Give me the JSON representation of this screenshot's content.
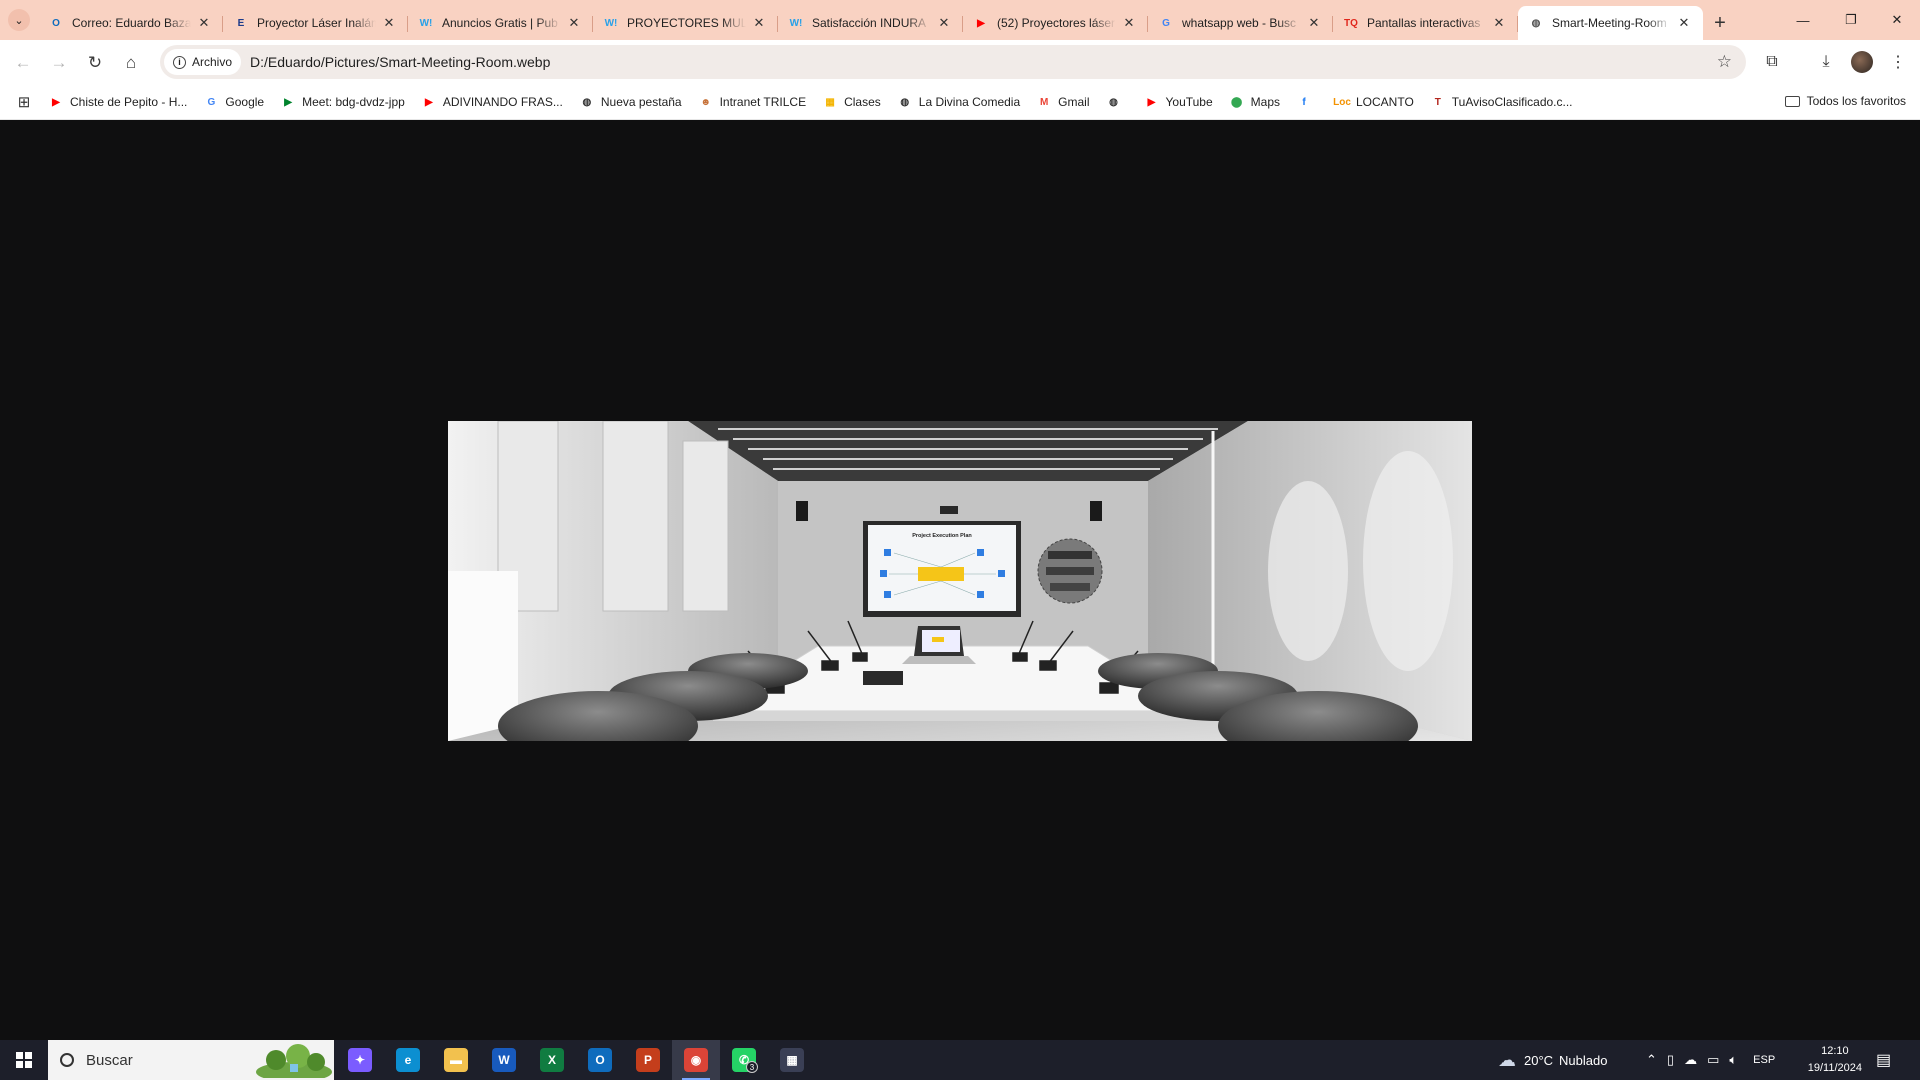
{
  "browser": {
    "tabs": [
      {
        "title": "Correo: Eduardo Baza",
        "favicon": "outlook-icon",
        "color": "#0f6cbd",
        "glyph": "O"
      },
      {
        "title": "Proyector Láser Inalám",
        "favicon": "e-letter-icon",
        "color": "#1b3a8a",
        "glyph": "E"
      },
      {
        "title": "Anuncios Gratis | Pub",
        "favicon": "w-logo-icon",
        "color": "#2aa1e8",
        "glyph": "W!"
      },
      {
        "title": "PROYECTORES MULTI",
        "favicon": "w-logo-icon",
        "color": "#2aa1e8",
        "glyph": "W!"
      },
      {
        "title": "Satisfacción INDURA",
        "favicon": "w-logo-icon",
        "color": "#2aa1e8",
        "glyph": "W!"
      },
      {
        "title": "(52) Proyectores láser",
        "favicon": "youtube-icon",
        "color": "#ff0000",
        "glyph": "▶"
      },
      {
        "title": "whatsapp web - Busc",
        "favicon": "google-icon",
        "color": "#4285f4",
        "glyph": "G"
      },
      {
        "title": "Pantallas interactivas",
        "favicon": "tq-logo-icon",
        "color": "#e0261b",
        "glyph": "TQ"
      },
      {
        "title": "Smart-Meeting-Room",
        "favicon": "globe-icon",
        "color": "#555555",
        "glyph": "◍",
        "active": true
      }
    ],
    "address": {
      "chip_label": "Archivo",
      "url": "D:/Eduardo/Pictures/Smart-Meeting-Room.webp"
    },
    "bookmarks": [
      {
        "label": "Chiste de Pepito - H...",
        "favicon": "youtube-icon",
        "color": "#ff0000",
        "glyph": "▶"
      },
      {
        "label": "Google",
        "favicon": "google-icon",
        "color": "#4285f4",
        "glyph": "G"
      },
      {
        "label": "Meet: bdg-dvdz-jpp",
        "favicon": "meet-icon",
        "color": "#00832d",
        "glyph": "▶"
      },
      {
        "label": "ADIVINANDO FRAS...",
        "favicon": "youtube-icon",
        "color": "#ff0000",
        "glyph": "▶"
      },
      {
        "label": "Nueva pestaña",
        "favicon": "globe-icon",
        "color": "#333333",
        "glyph": "◍"
      },
      {
        "label": "Intranet TRILCE",
        "favicon": "trilce-icon",
        "color": "#c7733a",
        "glyph": "☻"
      },
      {
        "label": "Clases",
        "favicon": "classroom-icon",
        "color": "#f4b400",
        "glyph": "▦"
      },
      {
        "label": "La Divina Comedia",
        "favicon": "globe-icon",
        "color": "#333333",
        "glyph": "◍"
      },
      {
        "label": "Gmail",
        "favicon": "gmail-icon",
        "color": "#ea4335",
        "glyph": "M"
      },
      {
        "label": "",
        "favicon": "globe-icon",
        "color": "#333333",
        "glyph": "◍"
      },
      {
        "label": "YouTube",
        "favicon": "youtube-icon",
        "color": "#ff0000",
        "glyph": "▶"
      },
      {
        "label": "Maps",
        "favicon": "maps-icon",
        "color": "#34a853",
        "glyph": "⬤"
      },
      {
        "label": "",
        "favicon": "facebook-icon",
        "color": "#1877f2",
        "glyph": "f"
      },
      {
        "label": "LOCANTO",
        "favicon": "locanto-icon",
        "color": "#f39200",
        "glyph": "Loc"
      },
      {
        "label": "TuAvisoClasificado.c...",
        "favicon": "tuaviso-icon",
        "color": "#b3261e",
        "glyph": "T"
      }
    ],
    "all_bookmarks_label": "Todos los favoritos"
  },
  "image": {
    "alt": "Smart-Meeting-Room",
    "screen_title": "Project Execution Plan"
  },
  "taskbar": {
    "search_placeholder": "Buscar",
    "apps": [
      {
        "name": "copilot-icon",
        "color": "#7b5cff",
        "glyph": "✦"
      },
      {
        "name": "edge-icon",
        "color": "#0c8fd1",
        "glyph": "e"
      },
      {
        "name": "file-explorer-icon",
        "color": "#f2c14e",
        "glyph": "▬"
      },
      {
        "name": "word-icon",
        "color": "#185abd",
        "glyph": "W"
      },
      {
        "name": "excel-icon",
        "color": "#107c41",
        "glyph": "X"
      },
      {
        "name": "outlook-icon",
        "color": "#0f6cbd",
        "glyph": "O"
      },
      {
        "name": "powerpoint-icon",
        "color": "#c43e1c",
        "glyph": "P"
      },
      {
        "name": "chrome-icon",
        "color": "#db4437",
        "glyph": "◉",
        "active": true
      },
      {
        "name": "whatsapp-icon",
        "color": "#25d366",
        "glyph": "✆",
        "badge": "3"
      },
      {
        "name": "calculator-icon",
        "color": "#3a3f55",
        "glyph": "▦"
      }
    ],
    "weather": {
      "temp": "20°C",
      "condition": "Nublado"
    },
    "language": "ESP",
    "time": "12:10",
    "date": "19/11/2024"
  }
}
